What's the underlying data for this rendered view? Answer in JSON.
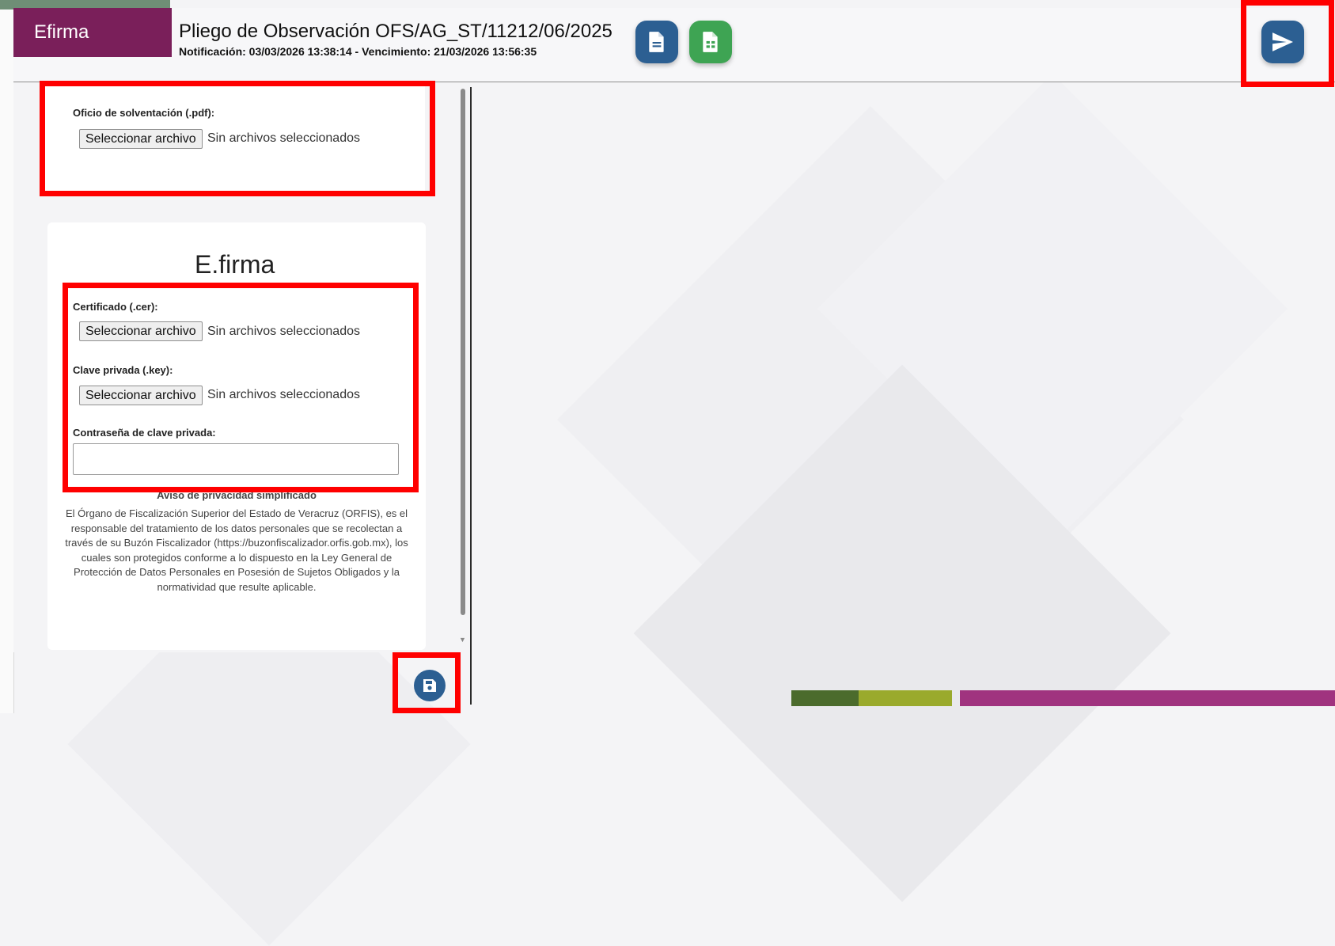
{
  "header": {
    "brand": "Efirma",
    "title": "Pliego de Observación OFS/AG_ST/11212/06/2025",
    "subtitle": "Notificación: 03/03/2026 13:38:14 - Vencimiento: 21/03/2026 13:56:35",
    "buttons": {
      "document_icon": "file-text-icon",
      "spreadsheet_icon": "file-spreadsheet-icon",
      "send_icon": "send-icon"
    }
  },
  "upload_pdf": {
    "label": "Oficio de solventación (.pdf):",
    "button": "Seleccionar archivo",
    "status": "Sin archivos seleccionados"
  },
  "efirma": {
    "heading": "E.firma",
    "certificate": {
      "label": "Certificado (.cer):",
      "button": "Seleccionar archivo",
      "status": "Sin archivos seleccionados"
    },
    "private_key": {
      "label": "Clave privada (.key):",
      "button": "Seleccionar archivo",
      "status": "Sin archivos seleccionados"
    },
    "password": {
      "label": "Contraseña de clave privada:",
      "value": ""
    },
    "privacy_title": "Aviso de privacidad simplificado",
    "privacy_text": "El Órgano de Fiscalización Superior del Estado de Veracruz (ORFIS), es el responsable del tratamiento de los datos personales que se recolectan a través de su Buzón Fiscalizador (https://buzonfiscalizador.orfis.gob.mx), los cuales son protegidos conforme a lo dispuesto en la Ley General de Protección de Datos Personales en Posesión de Sujetos Obligados y la normatividad que resulte aplicable."
  },
  "footer": {
    "save_icon": "save-icon"
  },
  "colors": {
    "brand": "#7a1f5a",
    "primary_button": "#2c5f92",
    "green_button": "#3ea453",
    "highlight": "#ff0000",
    "bar_dark_green": "#4b6b2c",
    "bar_olive": "#9aaa2c",
    "bar_magenta": "#a0337f"
  }
}
